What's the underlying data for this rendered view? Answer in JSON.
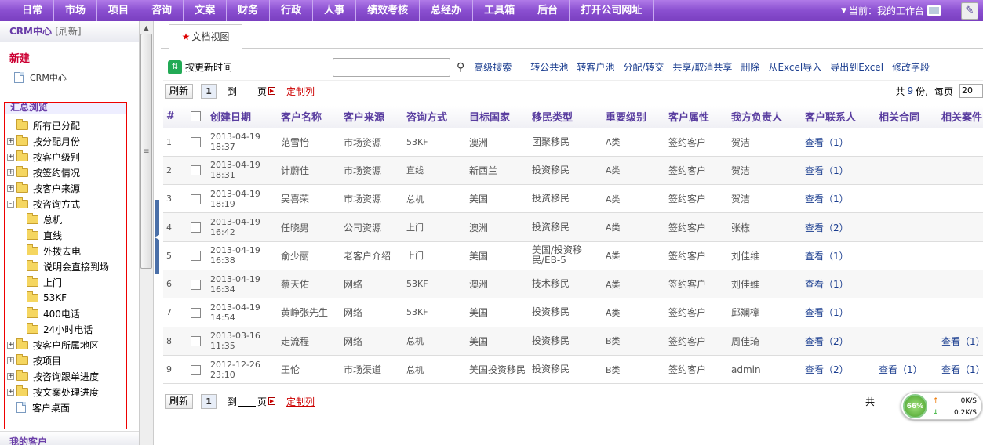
{
  "nav": {
    "items": [
      "日常",
      "市场",
      "项目",
      "咨询",
      "文案",
      "财务",
      "行政",
      "人事",
      "绩效考核",
      "总经办",
      "工具箱",
      "后台",
      "打开公司网址"
    ],
    "current_label": "当前：我的工作台"
  },
  "sidebar": {
    "title": "CRM中心",
    "refresh": "[刷新]",
    "new_label": "新建",
    "crm_node": "CRM中心",
    "summary_title": "汇总浏览",
    "tree": [
      {
        "label": "所有已分配",
        "level": 0,
        "expand": ""
      },
      {
        "label": "按分配月份",
        "level": 0,
        "expand": "+"
      },
      {
        "label": "按客户级别",
        "level": 0,
        "expand": "+"
      },
      {
        "label": "按签约情况",
        "level": 0,
        "expand": "+"
      },
      {
        "label": "按客户来源",
        "level": 0,
        "expand": "+"
      },
      {
        "label": "按咨询方式",
        "level": 0,
        "expand": "-"
      },
      {
        "label": "总机",
        "level": 1,
        "expand": ""
      },
      {
        "label": "直线",
        "level": 1,
        "expand": ""
      },
      {
        "label": "外拨去电",
        "level": 1,
        "expand": ""
      },
      {
        "label": "说明会直接到场",
        "level": 1,
        "expand": ""
      },
      {
        "label": "上门",
        "level": 1,
        "expand": ""
      },
      {
        "label": "53KF",
        "level": 1,
        "expand": ""
      },
      {
        "label": "400电话",
        "level": 1,
        "expand": ""
      },
      {
        "label": "24小时电话",
        "level": 1,
        "expand": ""
      },
      {
        "label": "按客户所属地区",
        "level": 0,
        "expand": "+"
      },
      {
        "label": "按项目",
        "level": 0,
        "expand": "+"
      },
      {
        "label": "按咨询跟单进度",
        "level": 0,
        "expand": "+"
      },
      {
        "label": "按文案处理进度",
        "level": 0,
        "expand": "+"
      },
      {
        "label": "客户桌面",
        "level": 0,
        "expand": "",
        "page": true
      }
    ],
    "my_customers": "我的客户"
  },
  "main": {
    "tab": "文档视图",
    "sort_label": "按更新时间",
    "search_placeholder": "",
    "search_button": "高级搜索",
    "actions": [
      "转公共池",
      "转客户池",
      "分配/转交",
      "共享/取消共享",
      "删除",
      "从Excel导入",
      "导出到Excel",
      "修改字段"
    ],
    "pager": {
      "refresh": "刷新",
      "page": "1",
      "to": "到",
      "page_unit": "页",
      "customize": "定制列",
      "total_prefix": "共",
      "total_count": "9",
      "total_suffix": "份,",
      "per_page_label": "每页",
      "per_page": "20"
    }
  },
  "table": {
    "columns": [
      "#",
      "",
      "创建日期",
      "客户名称",
      "客户来源",
      "咨询方式",
      "目标国家",
      "移民类型",
      "重要级别",
      "客户属性",
      "我方负责人",
      "客户联系人",
      "相关合同",
      "相关案件"
    ],
    "rows": [
      {
        "n": "1",
        "date": "2013-04-19 18:37",
        "name": "范雪怡",
        "source": "市场资源",
        "method": "53KF",
        "country": "澳洲",
        "type": "团聚移民",
        "level": "A类",
        "attr": "签约客户",
        "owner": "贺洁",
        "contact": "查看（1）",
        "contract": "",
        "case": ""
      },
      {
        "n": "2",
        "date": "2013-04-19 18:31",
        "name": "计蔚佳",
        "source": "市场资源",
        "method": "直线",
        "country": "新西兰",
        "type": "投资移民",
        "level": "A类",
        "attr": "签约客户",
        "owner": "贺洁",
        "contact": "查看（1）",
        "contract": "",
        "case": ""
      },
      {
        "n": "3",
        "date": "2013-04-19 18:19",
        "name": "吴喜荣",
        "source": "市场资源",
        "method": "总机",
        "country": "美国",
        "type": "投资移民",
        "level": "A类",
        "attr": "签约客户",
        "owner": "贺洁",
        "contact": "查看（1）",
        "contract": "",
        "case": ""
      },
      {
        "n": "4",
        "date": "2013-04-19 16:42",
        "name": "任晓男",
        "source": "公司资源",
        "method": "上门",
        "country": "澳洲",
        "type": "投资移民",
        "level": "A类",
        "attr": "签约客户",
        "owner": "张栋",
        "contact": "查看（2）",
        "contract": "",
        "case": ""
      },
      {
        "n": "5",
        "date": "2013-04-19 16:38",
        "name": "俞少丽",
        "source": "老客户介绍",
        "method": "上门",
        "country": "美国",
        "type": "美国/投资移民/EB-5",
        "level": "A类",
        "attr": "签约客户",
        "owner": "刘佳维",
        "contact": "查看（1）",
        "contract": "",
        "case": ""
      },
      {
        "n": "6",
        "date": "2013-04-19 16:34",
        "name": "蔡天佑",
        "source": "网络",
        "method": "53KF",
        "country": "澳洲",
        "type": "技术移民",
        "level": "A类",
        "attr": "签约客户",
        "owner": "刘佳维",
        "contact": "查看（1）",
        "contract": "",
        "case": ""
      },
      {
        "n": "7",
        "date": "2013-04-19 14:54",
        "name": "黄峥张先生",
        "source": "网络",
        "method": "53KF",
        "country": "美国",
        "type": "投资移民",
        "level": "A类",
        "attr": "签约客户",
        "owner": "邱斓樟",
        "contact": "查看（1）",
        "contract": "",
        "case": ""
      },
      {
        "n": "8",
        "date": "2013-03-16 11:35",
        "name": "走流程",
        "source": "网络",
        "method": "总机",
        "country": "美国",
        "type": "投资移民",
        "level": "B类",
        "attr": "签约客户",
        "owner": "周佳琦",
        "contact": "查看（2）",
        "contract": "",
        "case": "查看（1）"
      },
      {
        "n": "9",
        "date": "2012-12-26 23:10",
        "name": "王伦",
        "source": "市场渠道",
        "method": "总机",
        "country": "美国投资移民",
        "type": "投资移民",
        "level": "B类",
        "attr": "签约客户",
        "owner": "admin",
        "contact": "查看（2）",
        "contract": "查看（1）",
        "case": "查看（1）"
      }
    ]
  },
  "net_widget": {
    "percent": "66%",
    "up": "0K/S",
    "down": "0.2K/S"
  }
}
